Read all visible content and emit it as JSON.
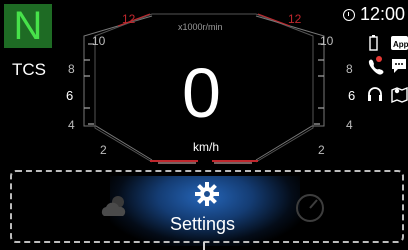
{
  "gear": {
    "value": "N"
  },
  "tcs": {
    "label": "TCS"
  },
  "tach": {
    "unit": "x1000r/min",
    "left_ticks": [
      "12",
      "10",
      "8",
      "6",
      "4",
      "2"
    ],
    "right_ticks": [
      "12",
      "10",
      "8",
      "6",
      "4",
      "2"
    ]
  },
  "speed": {
    "value": "0",
    "unit": "km/h"
  },
  "clock": {
    "time": "12:00"
  },
  "status": {
    "app_label": "App"
  },
  "dock": {
    "selected_label": "Settings",
    "items": [
      "weather",
      "settings",
      "gauge"
    ]
  },
  "colors": {
    "gear_bg": "#1e6b24",
    "gear_fg": "#47e24a",
    "redline": "#c0272d",
    "accent": "#2565b8"
  }
}
